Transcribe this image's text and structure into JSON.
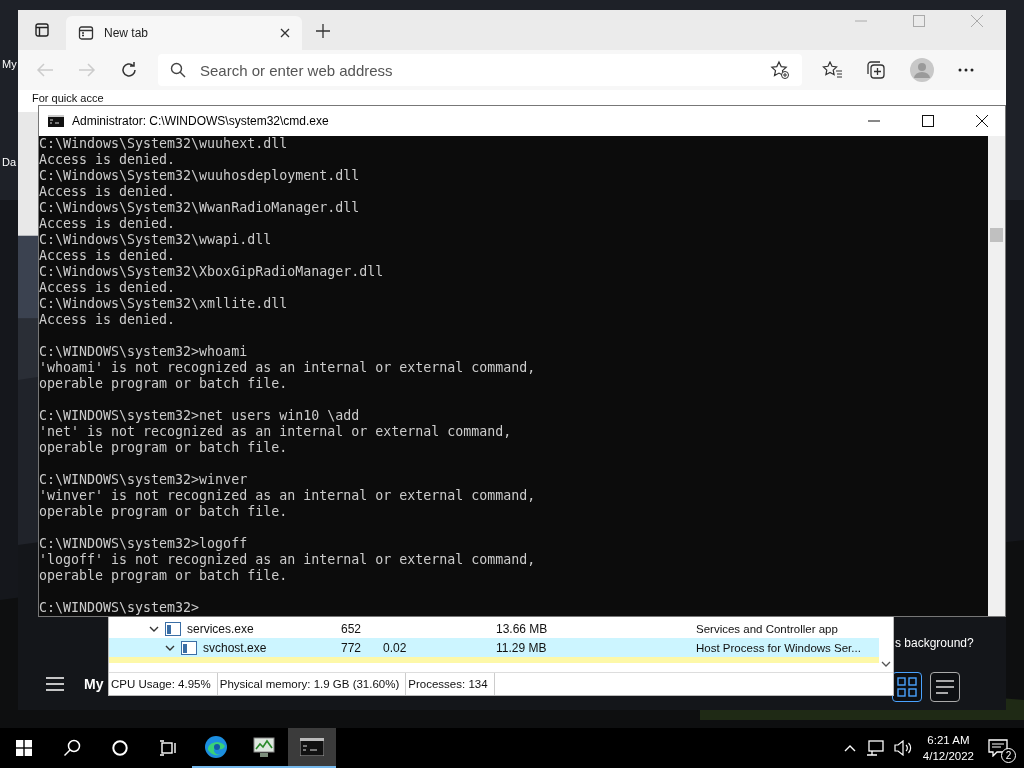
{
  "desktop": {
    "icon_labels": [
      "My",
      "Da"
    ]
  },
  "browser": {
    "tabs": [
      {
        "label": "New tab",
        "selected": true
      }
    ],
    "address": {
      "placeholder": "Search or enter web address"
    },
    "favorites_hint": "For quick acce",
    "page": {
      "menu_label": "My",
      "background_prompt": "s background?",
      "layout_buttons": [
        {
          "kind": "grid",
          "selected": true
        },
        {
          "kind": "list",
          "selected": false
        }
      ]
    }
  },
  "console": {
    "title": "Administrator: C:\\WINDOWS\\system32\\cmd.exe",
    "blocks": [
      [
        "C:\\Windows\\System32\\wuuhext.dll",
        "Access is denied.",
        "C:\\Windows\\System32\\wuuhosdeployment.dll",
        "Access is denied.",
        "C:\\Windows\\System32\\WwanRadioManager.dll",
        "Access is denied.",
        "C:\\Windows\\System32\\wwapi.dll",
        "Access is denied.",
        "C:\\Windows\\System32\\XboxGipRadioManager.dll",
        "Access is denied.",
        "C:\\Windows\\System32\\xmllite.dll",
        "Access is denied."
      ],
      [
        "C:\\WINDOWS\\system32>whoami",
        "'whoami' is not recognized as an internal or external command,",
        "operable program or batch file."
      ],
      [
        "C:\\WINDOWS\\system32>net users win10 \\add",
        "'net' is not recognized as an internal or external command,",
        "operable program or batch file."
      ],
      [
        "C:\\WINDOWS\\system32>winver",
        "'winver' is not recognized as an internal or external command,",
        "operable program or batch file."
      ],
      [
        "C:\\WINDOWS\\system32>logoff",
        "'logoff' is not recognized as an internal or external command,",
        "operable program or batch file."
      ],
      [
        "C:\\WINDOWS\\system32>"
      ]
    ]
  },
  "task_manager": {
    "processes": [
      {
        "name": "services.exe",
        "pid": "652",
        "memory": "13.66 MB",
        "description": "Services and Controller app",
        "expanded": true,
        "selected": false,
        "children": [
          {
            "name": "svchost.exe",
            "pid": "772",
            "cpu": "0.02",
            "memory": "11.29 MB",
            "description": "Host Process for Windows Ser...",
            "expanded": true,
            "selected": true
          }
        ]
      }
    ],
    "status": [
      "CPU Usage: 4.95%",
      "Physical memory: 1.9 GB (31.60%)",
      "Processes: 134"
    ]
  },
  "taskbar": {
    "apps": [
      {
        "kind": "search",
        "selected": false
      },
      {
        "kind": "cortana",
        "selected": false
      },
      {
        "kind": "taskview",
        "selected": false
      },
      {
        "kind": "edge",
        "selected": false
      },
      {
        "kind": "taskmgr",
        "selected": false
      },
      {
        "kind": "cmd",
        "selected": true
      }
    ],
    "clock": {
      "time": "6:21 AM",
      "date": "4/12/2022"
    },
    "notifications": "2"
  }
}
